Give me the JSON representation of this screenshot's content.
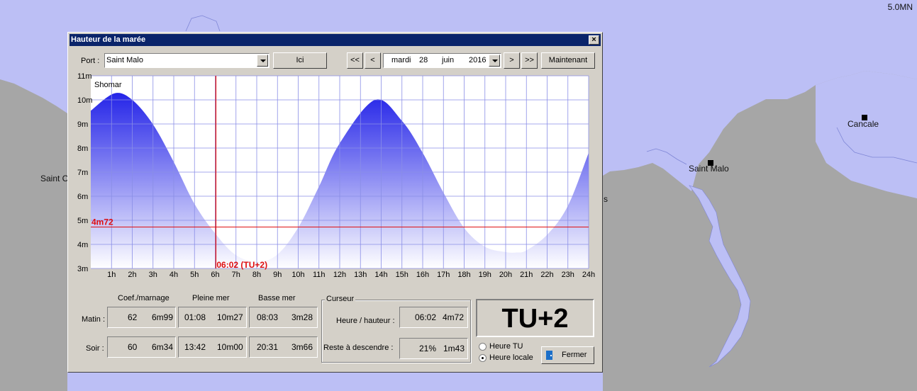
{
  "map": {
    "scale_label": "5.0MN",
    "places": [
      {
        "name": "Cancale",
        "label": "Cancale"
      },
      {
        "name": "Saint Malo",
        "label": "Saint Malo"
      },
      {
        "name": "Saint C",
        "label": "Saint C"
      },
      {
        "name": "s",
        "label": "s"
      }
    ],
    "colors": {
      "sea": "#bcbff5",
      "land": "#a6a6a6"
    }
  },
  "dialog": {
    "title": "Hauteur de la marée",
    "close_glyph": "×",
    "port_label": "Port :",
    "port_value": "Saint Malo",
    "here_button": "Ici",
    "nav": {
      "first": "<<",
      "prev": "<",
      "next": ">",
      "last": ">>"
    },
    "date": {
      "weekday": "mardi",
      "day": "28",
      "month": "juin",
      "year": "2016"
    },
    "now_button": "Maintenant"
  },
  "chart_data": {
    "type": "area",
    "source_label": "Shomar",
    "x_ticks": [
      "1h",
      "2h",
      "3h",
      "4h",
      "5h",
      "6h",
      "7h",
      "8h",
      "9h",
      "10h",
      "11h",
      "12h",
      "13h",
      "14h",
      "15h",
      "16h",
      "17h",
      "18h",
      "19h",
      "20h",
      "21h",
      "22h",
      "23h",
      "24h"
    ],
    "y_ticks": [
      "3m",
      "4m",
      "5m",
      "6m",
      "7m",
      "8m",
      "9m",
      "10m",
      "11m"
    ],
    "xlim": [
      0,
      24
    ],
    "ylim": [
      3,
      11
    ],
    "series": [
      {
        "x": [
          0,
          1.13,
          2,
          3,
          4,
          5,
          6,
          7,
          8.05,
          9,
          10,
          11,
          12,
          13.7,
          15,
          16,
          17,
          18,
          19,
          20,
          20.52,
          21,
          22,
          23,
          24
        ],
        "y": [
          9.55,
          10.27,
          10.0,
          8.98,
          7.42,
          5.68,
          4.45,
          3.55,
          3.28,
          3.58,
          4.7,
          6.4,
          8.2,
          10.0,
          9.13,
          7.8,
          6.15,
          4.68,
          3.9,
          3.68,
          3.66,
          3.75,
          4.4,
          5.6,
          7.8
        ]
      }
    ],
    "cursor": {
      "x": 6.03,
      "y": 4.72,
      "height_label": "4m72",
      "time_label": "06:02 (TU+2)"
    },
    "grid": true,
    "colors": {
      "fill_top": "#2424e8",
      "fill_bottom": "#ffffff",
      "grid": "#8a8ee6",
      "cursor": "#e01010"
    }
  },
  "table": {
    "headers": {
      "coef": "Coef./marnage",
      "high": "Pleine mer",
      "low": "Basse mer"
    },
    "rows": [
      {
        "label": "Matin :",
        "coef": "62",
        "range": "6m99",
        "high_time": "01:08",
        "high_height": "10m27",
        "low_time": "08:03",
        "low_height": "3m28"
      },
      {
        "label": "Soir :",
        "coef": "60",
        "range": "6m34",
        "high_time": "13:42",
        "high_height": "10m00",
        "low_time": "20:31",
        "low_height": "3m66"
      }
    ]
  },
  "cursor_panel": {
    "title": "Curseur",
    "time_height_label": "Heure / hauteur :",
    "time_value": "06:02",
    "height_value": "4m72",
    "remaining_label": "Reste à descendre :",
    "remaining_pct": "21%",
    "remaining_height": "1m43"
  },
  "timezone": {
    "display": "TU+2",
    "option_tu": "Heure TU",
    "option_local": "Heure locale",
    "selected": "Heure locale"
  },
  "close_button": "Fermer"
}
